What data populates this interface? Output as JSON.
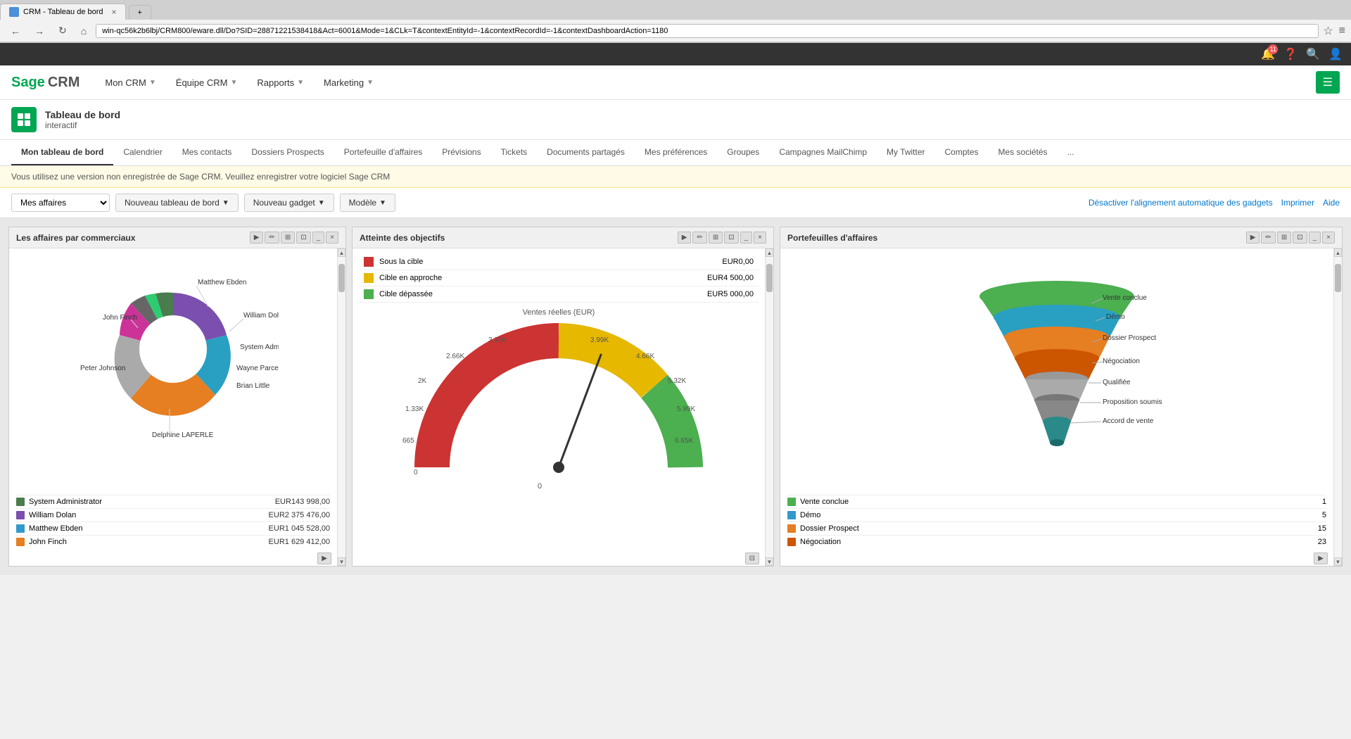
{
  "browser": {
    "tab_title": "CRM - Tableau de bord",
    "url": "win-qc56k2b6lbj/CRM800/eware.dll/Do?SID=28871221538418&Act=6001&Mode=1&CLk=T&contextEntityId=-1&contextRecordId=-1&contextDashboardAction=1180",
    "nav_back": "←",
    "nav_forward": "→",
    "nav_refresh": "↻",
    "nav_home": "⌂"
  },
  "header": {
    "logo_sage": "Sage",
    "logo_crm": " CRM",
    "nav_items": [
      {
        "label": "Mon CRM",
        "has_arrow": true
      },
      {
        "label": "Équipe CRM",
        "has_arrow": true
      },
      {
        "label": "Rapports",
        "has_arrow": true
      },
      {
        "label": "Marketing",
        "has_arrow": true
      }
    ]
  },
  "page_title": {
    "text_line1": "Tableau de bord",
    "text_line2": "interactif"
  },
  "tabs": [
    {
      "label": "Mon tableau de bord",
      "active": true
    },
    {
      "label": "Calendrier"
    },
    {
      "label": "Mes contacts"
    },
    {
      "label": "Dossiers Prospects"
    },
    {
      "label": "Portefeuille d'affaires"
    },
    {
      "label": "Prévisions"
    },
    {
      "label": "Tickets"
    },
    {
      "label": "Documents partagés"
    },
    {
      "label": "Mes préférences"
    },
    {
      "label": "Groupes"
    },
    {
      "label": "Campagnes MailChimp"
    },
    {
      "label": "My Twitter"
    },
    {
      "label": "Comptes"
    },
    {
      "label": "Mes sociétés"
    },
    {
      "label": "..."
    }
  ],
  "warning_message": "Vous utilisez une version non enregistrée de Sage CRM. Veuillez enregistrer votre logiciel Sage CRM",
  "toolbar": {
    "select_value": "Mes affaires",
    "btn_new_dashboard": "Nouveau tableau de bord",
    "btn_new_gadget": "Nouveau gadget",
    "btn_model": "Modèle",
    "link_auto_align": "Désactiver l'alignement automatique des gadgets",
    "link_print": "Imprimer",
    "link_help": "Aide"
  },
  "widget1": {
    "title": "Les affaires par commerciaux",
    "legend": [
      {
        "color": "#4a7c4e",
        "label": "System Administrator",
        "value": "EUR143 998,00"
      },
      {
        "color": "#7b4fad",
        "label": "William Dolan",
        "value": "EUR2 375 476,00"
      },
      {
        "color": "#3399cc",
        "label": "Matthew Ebden",
        "value": "EUR1 045 528,00"
      },
      {
        "color": "#e67e22",
        "label": "John Finch",
        "value": "EUR1 629 412,00"
      }
    ],
    "donut_segments": [
      {
        "color": "#4a7c4e",
        "label": "System Administrator",
        "start": 0,
        "end": 45
      },
      {
        "color": "#7b4fad",
        "label": "William Dolan",
        "start": 45,
        "end": 145
      },
      {
        "color": "#3399cc",
        "label": "Matthew Ebden",
        "start": 145,
        "end": 205
      },
      {
        "color": "#e67e22",
        "label": "John Finch",
        "start": 205,
        "end": 280
      },
      {
        "color": "#cccccc",
        "label": "Peter Johnson",
        "start": 280,
        "end": 315
      },
      {
        "color": "#cc3333",
        "label": "Wayne Parcelis",
        "start": 315,
        "end": 330
      },
      {
        "color": "#999999",
        "label": "System Administrator",
        "start": 330,
        "end": 345
      },
      {
        "color": "#2ecc71",
        "label": "Delphine LAPERLE",
        "start": 345,
        "end": 360
      }
    ],
    "names_on_chart": [
      "Matthew Ebden",
      "John Finch",
      "William Dolan",
      "System Administrator",
      "Wayne Parcelis",
      "Brian Little",
      "Peter Johnson",
      "Delphine LAPERLE"
    ]
  },
  "widget2": {
    "title": "Atteinte des objectifs",
    "legend": [
      {
        "color": "#cc3333",
        "label": "Sous la cible",
        "value": "EUR0,00"
      },
      {
        "color": "#e6b800",
        "label": "Cible en approche",
        "value": "EUR4 500,00"
      },
      {
        "color": "#4caf50",
        "label": "Cible dépassée",
        "value": "EUR5 000,00"
      }
    ],
    "gauge_label": "Ventes réelles (EUR)",
    "gauge_ticks": [
      "0",
      "665",
      "1.33K",
      "2K",
      "2.66K",
      "3.33K",
      "3.99K",
      "4.66K",
      "5.32K",
      "5.99K",
      "6.65K"
    ],
    "gauge_bottom": "0"
  },
  "widget3": {
    "title": "Portefeuilles d'affaires",
    "funnel_labels": [
      "Vente conclue",
      "Démo",
      "Dossier Prospect",
      "Négociation",
      "Qualifiée",
      "Proposition soumise",
      "Accord de vente"
    ],
    "legend": [
      {
        "color": "#4caf50",
        "label": "Vente conclue",
        "value": "1"
      },
      {
        "color": "#3399cc",
        "label": "Démo",
        "value": "5"
      },
      {
        "color": "#e67e22",
        "label": "Dossier Prospect",
        "value": "15"
      },
      {
        "color": "#cc5500",
        "label": "Négociation",
        "value": "23"
      }
    ]
  }
}
